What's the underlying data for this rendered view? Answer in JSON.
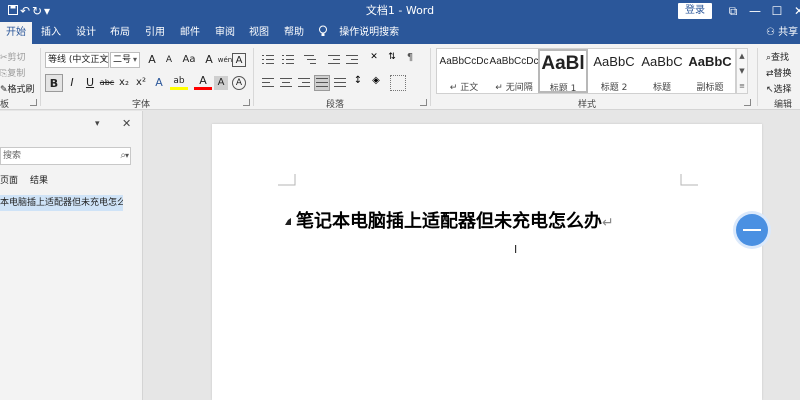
{
  "window": {
    "title": "文档1 - Word",
    "login_label": "登录",
    "quick_access": {
      "save_icon": "floppy-icon",
      "undo_icon": "↶",
      "redo_icon": "↻",
      "customize_icon": "▾"
    },
    "controls": {
      "ribbon_display": "⧉",
      "minimize": "—",
      "maximize": "☐",
      "close": "✕"
    }
  },
  "tabs": [
    "开始",
    "插入",
    "设计",
    "布局",
    "引用",
    "邮件",
    "审阅",
    "视图",
    "帮助"
  ],
  "tell_me": "操作说明搜索",
  "share": "共享",
  "ribbon": {
    "clipboard": {
      "cut": "剪切",
      "copy": "复制",
      "format_painter": "格式刷",
      "group_label": "板"
    },
    "font": {
      "font_name": "等线 (中文正文",
      "font_size": "二号",
      "grow": "A",
      "shrink": "A",
      "change_case": "Aa",
      "clear": "A",
      "phonetic": "wén",
      "border_char": "A",
      "bold": "B",
      "italic": "I",
      "underline": "U",
      "strike": "abc",
      "subscript": "x₂",
      "superscript": "x²",
      "text_effect": "A",
      "highlight": "ab",
      "font_color": "A",
      "shading": "A",
      "enclosed": "A",
      "group_label": "字体"
    },
    "paragraph": {
      "group_label": "段落"
    },
    "styles": {
      "group_label": "样式",
      "items": [
        {
          "sample": "AaBbCcDc",
          "name": "↵ 正文"
        },
        {
          "sample": "AaBbCcDc",
          "name": "↵ 无间隔"
        },
        {
          "sample": "AaBl",
          "name": "标题 1"
        },
        {
          "sample": "AaBbC",
          "name": "标题 2"
        },
        {
          "sample": "AaBbC",
          "name": "标题"
        },
        {
          "sample": "AaBbC",
          "name": "副标题"
        }
      ]
    },
    "editing": {
      "find": "查找",
      "replace": "替换",
      "select": "选择",
      "group_label": "编辑"
    }
  },
  "nav": {
    "search_placeholder": "搜索",
    "tabs": [
      "页面",
      "结果"
    ],
    "heading": "本电脑插上适配器但未充电怎么办",
    "menu_icon": "▾",
    "close_icon": "✕",
    "search_icon": "⌕"
  },
  "document": {
    "title": "笔记本电脑插上适配器但未充电怎么办",
    "paragraph_mark": "↵"
  },
  "colors": {
    "accent": "#2b579a",
    "highlight": "#ffff00",
    "font_color": "#ff0000",
    "float_button": "#4a90e2"
  }
}
